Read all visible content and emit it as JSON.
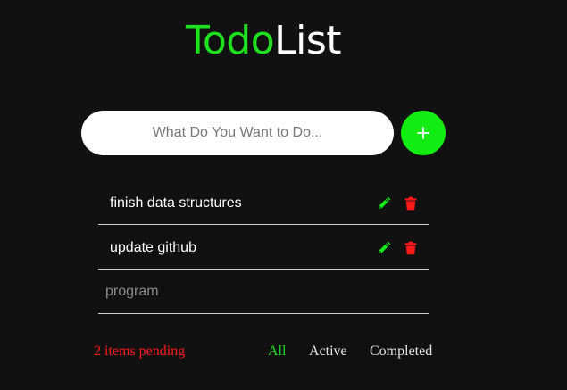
{
  "app": {
    "title_part1": "Todo",
    "title_part2": "List"
  },
  "new_todo": {
    "placeholder": "What Do You Want to Do...",
    "value": "",
    "add_label": "+"
  },
  "todos": [
    {
      "text": "finish data structures",
      "edit_icon": "pencil-icon",
      "delete_icon": "trash-icon"
    },
    {
      "text": "update github",
      "edit_icon": "pencil-icon",
      "delete_icon": "trash-icon"
    }
  ],
  "inline_input": {
    "placeholder": "program",
    "value": ""
  },
  "footer": {
    "pending_text": "2 items pending",
    "filters": [
      {
        "label": "All",
        "active": true
      },
      {
        "label": "Active",
        "active": false
      },
      {
        "label": "Completed",
        "active": false
      }
    ]
  },
  "colors": {
    "background": "#111111",
    "accent_green": "#13ec13",
    "delete_red": "#ff1a1a",
    "pending_red": "#ff1a1a",
    "divider": "#cfcfcf"
  }
}
